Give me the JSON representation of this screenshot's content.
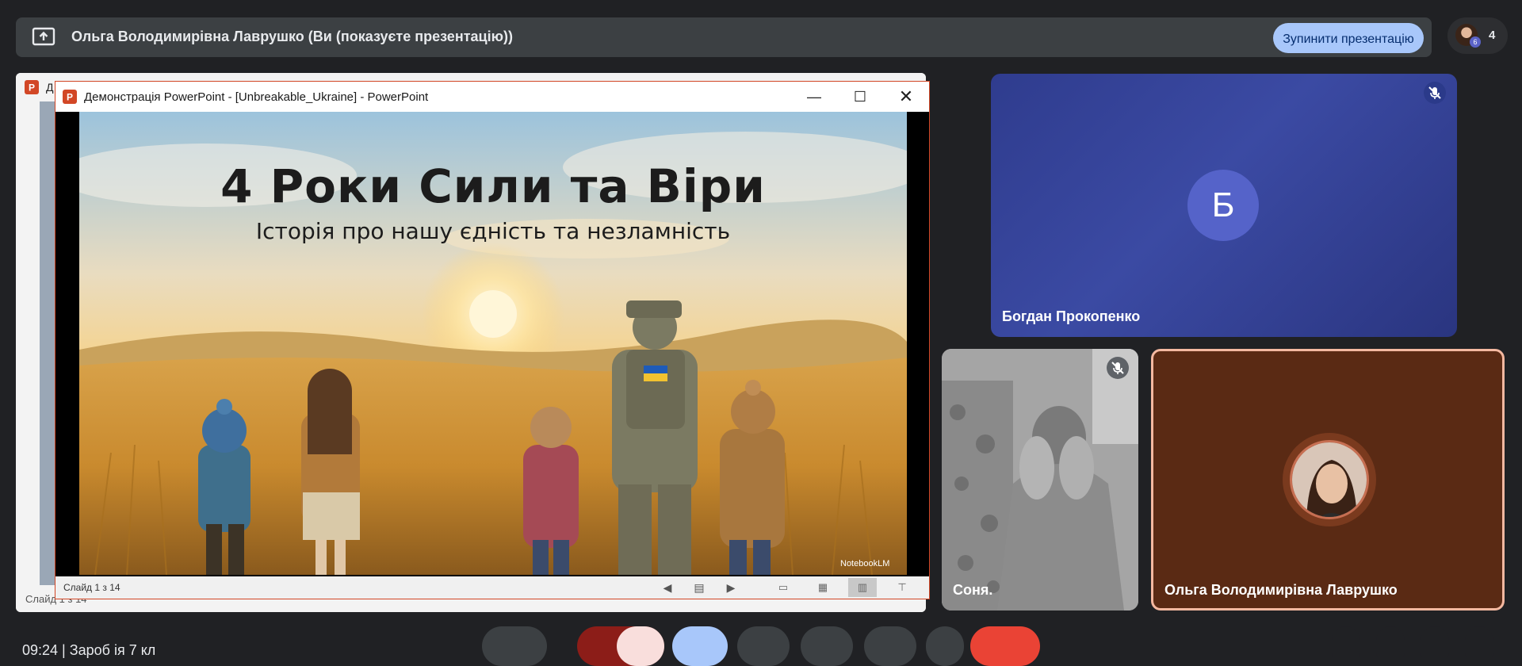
{
  "meet": {
    "presenting_banner": "Ольга Володимирівна Лаврушко (Ви (показуєте презентацію))",
    "stop_presenting_label": "Зупинити презентацію",
    "participant_count": "4",
    "participant_badge": "6"
  },
  "background_window": {
    "title_fragment": "Д",
    "status": "Слайд 1 з 14"
  },
  "ppt": {
    "window_title": "Демонстрація PowerPoint - [Unbreakable_Ukraine] - PowerPoint",
    "status_slide": "Слайд 1 з 14"
  },
  "slide": {
    "title": "4 Роки Сили та Віри",
    "subtitle": "Історія про нашу єдність та незламність",
    "watermark": "NotebookLM"
  },
  "participants": [
    {
      "name": "Богдан Прокопенко",
      "initial": "Б",
      "muted": true
    },
    {
      "name": "Соня.",
      "muted": true
    },
    {
      "name": "Ольга Володимирівна Лаврушко",
      "muted": false
    }
  ],
  "bottom": {
    "time": "09:24",
    "meeting_code_partial": "Зароб   ія 7 кл"
  },
  "colors": {
    "meet_bg": "#202124",
    "stop_button": "#a8c7fa",
    "ppt_accent": "#d24726",
    "end_call": "#ea4335",
    "bohdan_tile": "#3b4aa3",
    "olha_tile": "#5a2a14"
  }
}
